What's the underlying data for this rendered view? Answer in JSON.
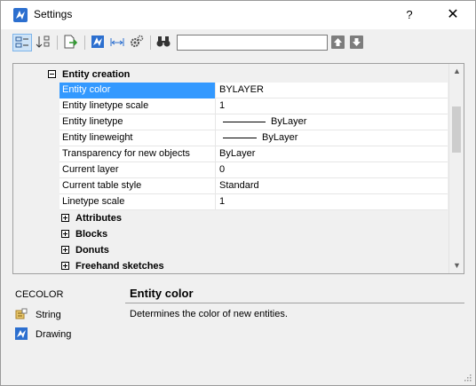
{
  "window": {
    "title": "Settings",
    "help_label": "?",
    "close_label": "✕"
  },
  "toolbar": {
    "search_value": "",
    "buttons": [
      "categorized-view",
      "alphabetical-view",
      "export",
      "drawing-settings",
      "dimension-settings",
      "system-settings",
      "find"
    ]
  },
  "grid": {
    "open_category": "Entity creation",
    "properties": [
      {
        "name": "Entity color",
        "value": "BYLAYER",
        "selected": true
      },
      {
        "name": "Entity linetype scale",
        "value": "1"
      },
      {
        "name": "Entity linetype",
        "value": "ByLayer",
        "line_sample": true
      },
      {
        "name": "Entity lineweight",
        "value": "ByLayer",
        "line_sample": true
      },
      {
        "name": "Transparency for new objects",
        "value": "ByLayer"
      },
      {
        "name": "Current layer",
        "value": "0"
      },
      {
        "name": "Current table style",
        "value": "Standard"
      },
      {
        "name": "Linetype scale",
        "value": "1"
      }
    ],
    "collapsed_categories": [
      "Attributes",
      "Blocks",
      "Donuts",
      "Freehand sketches"
    ]
  },
  "info": {
    "variable": "CECOLOR",
    "type": "String",
    "scope": "Drawing",
    "title": "Entity color",
    "description": "Determines the color of new entities."
  },
  "colors": {
    "accent": "#3399ff",
    "app_icon": "#2c6fcf"
  }
}
